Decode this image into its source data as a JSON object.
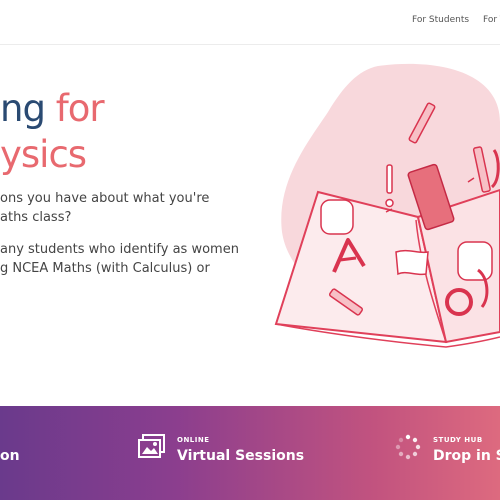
{
  "nav": {
    "students": "For Students",
    "teachers": "For T"
  },
  "hero": {
    "title_line1_dark": "ng",
    "title_line1_pink": "for",
    "title_line2_pink": "ysics",
    "para1_line1": "ons you have about what you're",
    "para1_line2": "aths class?",
    "para2_line1": "any students who identify as women",
    "para2_line2": "g NCEA Maths (with Calculus) or"
  },
  "services": {
    "item1_title": "on",
    "item2_label": "ONLINE",
    "item2_title": "Virtual Sessions",
    "item3_label": "STUDY HUB",
    "item3_title": "Drop in Ses"
  },
  "colors": {
    "accent_pink": "#e8696f",
    "title_blue": "#2a4a72",
    "band_start": "#6a3a8c",
    "band_end": "#dd6a7f"
  }
}
